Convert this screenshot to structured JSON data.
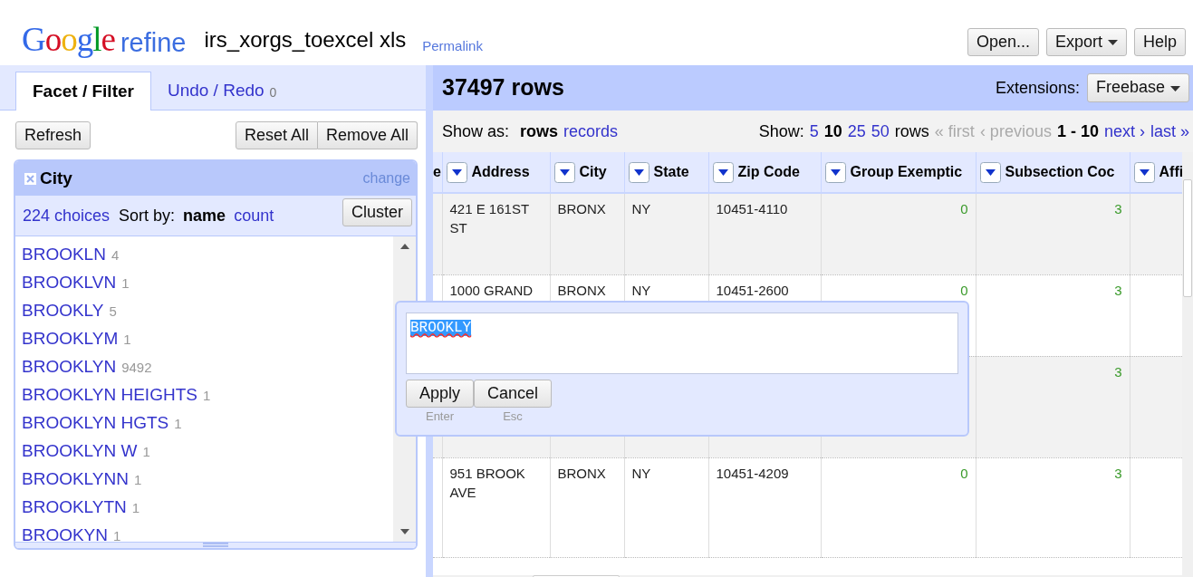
{
  "header": {
    "logo": {
      "brand": "Google",
      "product": "refine"
    },
    "project_name": "irs_xorgs_toexcel xls",
    "permalink": "Permalink",
    "buttons": [
      {
        "label": "Open...",
        "dropdown": false
      },
      {
        "label": "Export",
        "dropdown": true
      },
      {
        "label": "Help",
        "dropdown": false
      }
    ]
  },
  "left_panel": {
    "tabs": [
      {
        "label": "Facet / Filter",
        "selected": true
      },
      {
        "label": "Undo / Redo",
        "count": "0",
        "selected": false
      }
    ],
    "buttons": [
      {
        "label": "Refresh"
      },
      {
        "label": "Reset All"
      },
      {
        "label": "Remove All"
      }
    ],
    "facet": {
      "title": "City",
      "change": "change",
      "choices": "224 choices",
      "sort_label": "Sort by:",
      "sort_options": [
        {
          "label": "name",
          "selected": true
        },
        {
          "label": "count",
          "selected": false
        }
      ],
      "cluster": "Cluster",
      "items": [
        {
          "name": "BROOKLN",
          "count": "4"
        },
        {
          "name": "BROOKLVN",
          "count": "1"
        },
        {
          "name": "BROOKLY",
          "count": "5"
        },
        {
          "name": "BROOKLYM",
          "count": "1"
        },
        {
          "name": "BROOKLYN",
          "count": "9492"
        },
        {
          "name": "BROOKLYN HEIGHTS",
          "count": "1"
        },
        {
          "name": "BROOKLYN HGTS",
          "count": "1"
        },
        {
          "name": "BROOKLYN W",
          "count": "1"
        },
        {
          "name": "BROOKLYNN",
          "count": "1"
        },
        {
          "name": "BROOKLYTN",
          "count": "1"
        },
        {
          "name": "BROOKYN",
          "count": "1"
        }
      ]
    }
  },
  "right_panel": {
    "row_count": "37497 rows",
    "extensions_label": "Extensions:",
    "extensions_button": "Freebase",
    "show_as_label": "Show as:",
    "show_as": [
      {
        "label": "rows",
        "selected": true
      },
      {
        "label": "records",
        "selected": false
      }
    ],
    "show_label": "Show:",
    "page_sizes": [
      {
        "label": "5",
        "selected": false
      },
      {
        "label": "10",
        "selected": true
      },
      {
        "label": "25",
        "selected": false
      },
      {
        "label": "50",
        "selected": false
      }
    ],
    "rows_label": "rows",
    "pager": [
      {
        "label": "« first",
        "disabled": true
      },
      {
        "label": "‹ previous",
        "disabled": true
      },
      {
        "label": "1 - 10",
        "kind": "range"
      },
      {
        "label": "next ›",
        "disabled": false
      },
      {
        "label": "last »",
        "disabled": false
      }
    ],
    "table": {
      "columns": [
        "e",
        "Address",
        "City",
        "State",
        "Zip Code",
        "Group Exemptic",
        "Subsection Coc",
        "Affi"
      ],
      "rows": [
        {
          "address": "421 E 161ST ST",
          "city": "BRONX",
          "state": "NY",
          "zip": "10451-4110",
          "group_exemption": "0",
          "subsection": "3"
        },
        {
          "address": "1000 GRAND",
          "city": "BRONX",
          "state": "NY",
          "zip": "10451-2600",
          "group_exemption": "0",
          "subsection": "3"
        },
        {
          "subsection": "3"
        },
        {
          "address": "951 BROOK AVE",
          "city": "BRONX",
          "state": "NY",
          "zip": "10451-4209",
          "group_exemption": "0",
          "subsection": "3"
        }
      ]
    },
    "cell_editor": {
      "value": "BROOKLY",
      "buttons": [
        {
          "label": "Apply",
          "hint": "Enter"
        },
        {
          "label": "Cancel",
          "hint": "Esc"
        }
      ]
    }
  }
}
